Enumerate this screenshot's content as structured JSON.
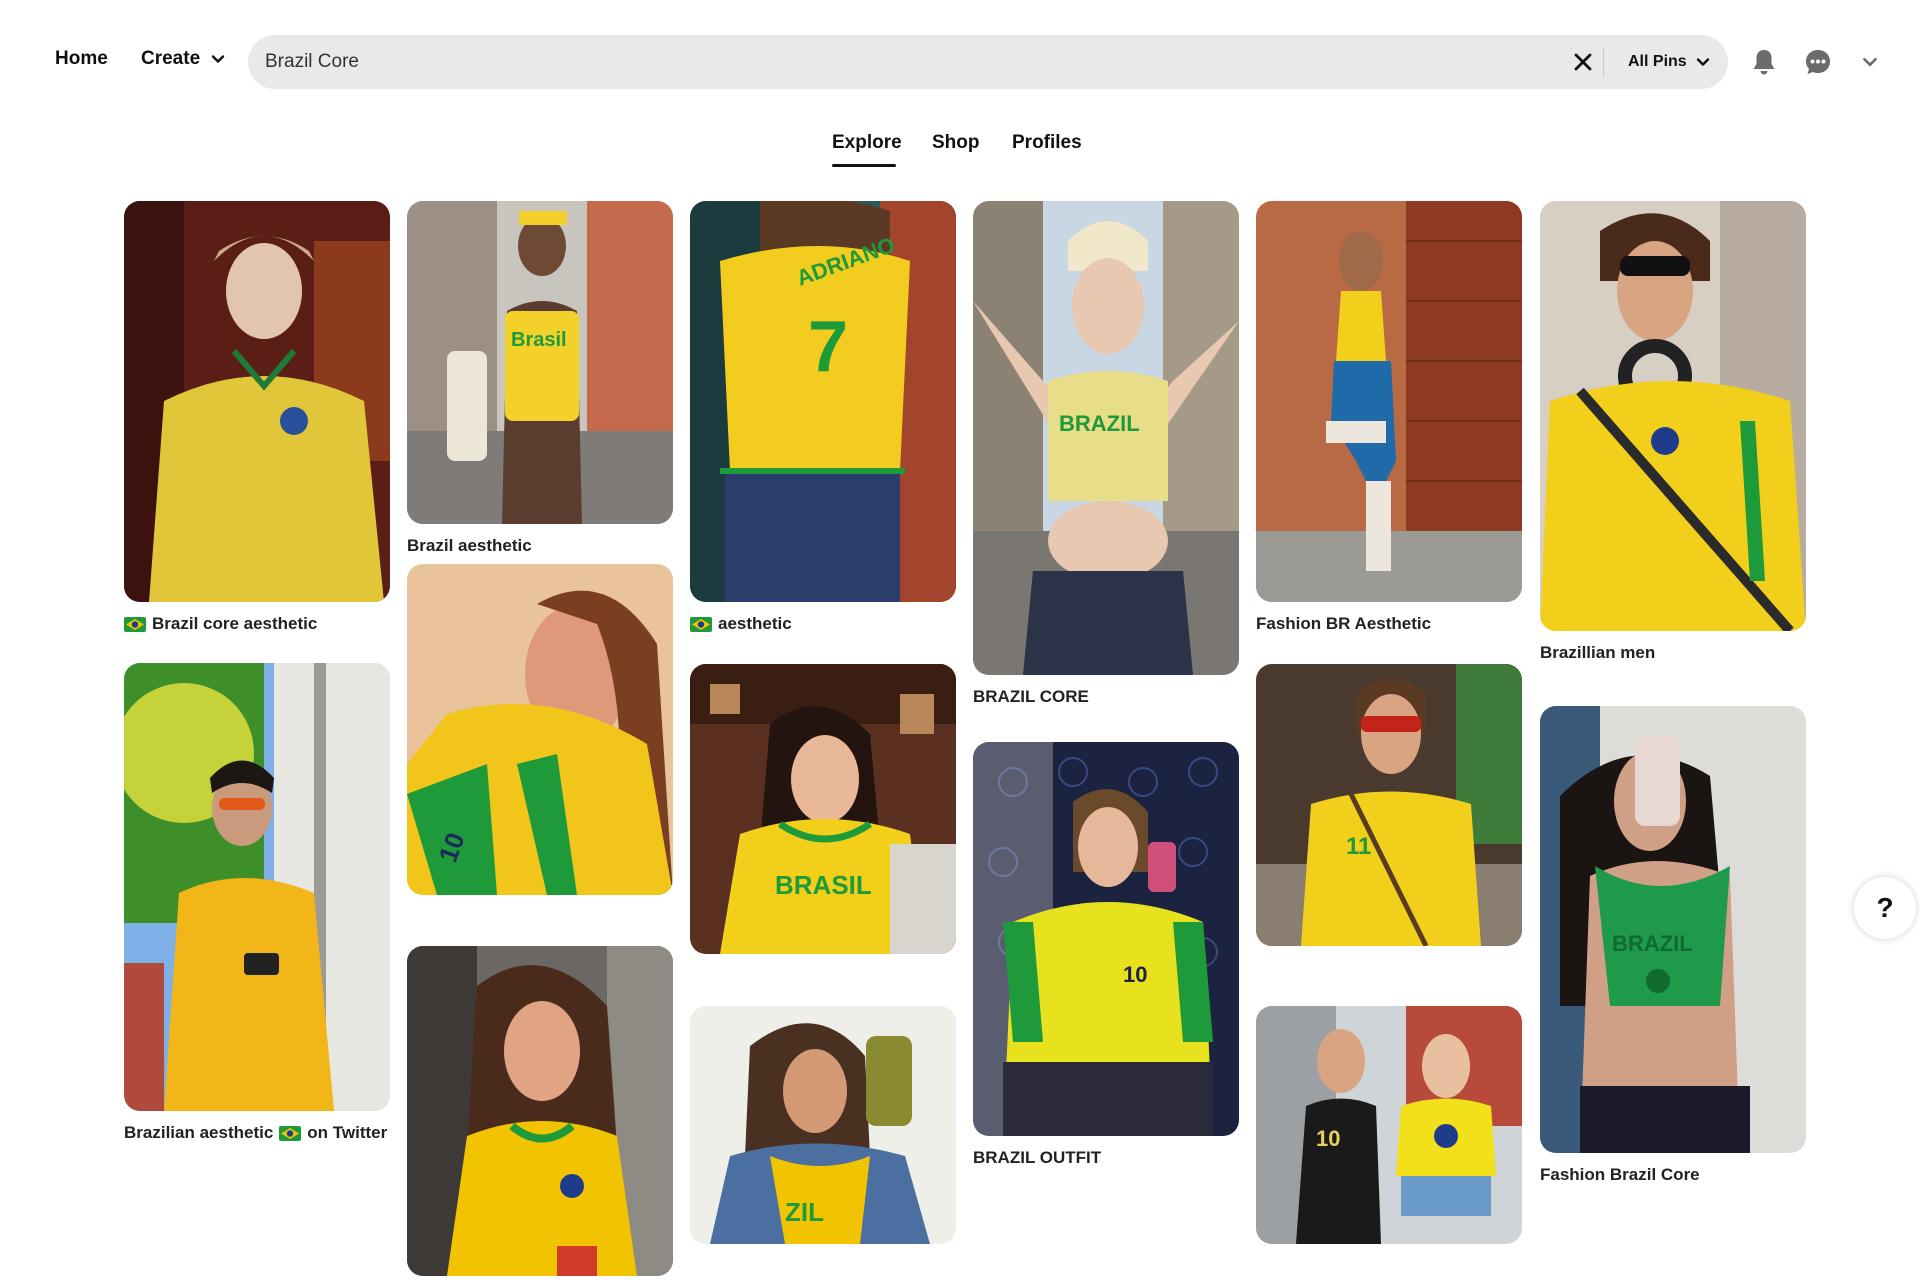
{
  "header": {
    "home_label": "Home",
    "create_label": "Create",
    "search_value": "Brazil Core",
    "search_scope": "All Pins",
    "icons": [
      "chevron-down-icon",
      "close-icon",
      "bell-icon",
      "chat-icon",
      "chevron-down-icon"
    ]
  },
  "tabs": [
    {
      "label": "Explore",
      "active": true
    },
    {
      "label": "Shop",
      "active": false
    },
    {
      "label": "Profiles",
      "active": false
    }
  ],
  "pins": {
    "p1": {
      "caption": "Brazil core aesthetic",
      "flag": true
    },
    "p2": {
      "caption": "Brazil aesthetic",
      "flag": false
    },
    "p3": {
      "caption": "aesthetic",
      "flag": true
    },
    "p4": {
      "caption": "BRAZIL CORE",
      "flag": false
    },
    "p5": {
      "caption": "Fashion BR Aesthetic",
      "flag": false
    },
    "p6": {
      "caption": "Brazillian men",
      "flag": false
    },
    "p7": {
      "caption_before": "Brazilian aesthetic",
      "caption_after": "on Twitter",
      "flag": true
    },
    "p8": {
      "caption": "",
      "flag": false
    },
    "p9": {
      "caption": "",
      "flag": false
    },
    "p10": {
      "caption": "BRAZIL OUTFIT",
      "flag": false
    },
    "p11": {
      "caption": "",
      "flag": false
    },
    "p12": {
      "caption": "Fashion Brazil Core",
      "flag": false
    },
    "p13": {
      "caption": "",
      "flag": false
    },
    "p14": {
      "caption": "",
      "flag": false
    },
    "p15": {
      "caption": "",
      "flag": false
    }
  },
  "help": {
    "label": "?"
  },
  "colors": {
    "brazil_yellow": "#f2c300",
    "brazil_green": "#1f9a3a",
    "brazil_blue": "#1f3c8c",
    "search_bg": "#e9e9e9",
    "text": "#111111"
  }
}
